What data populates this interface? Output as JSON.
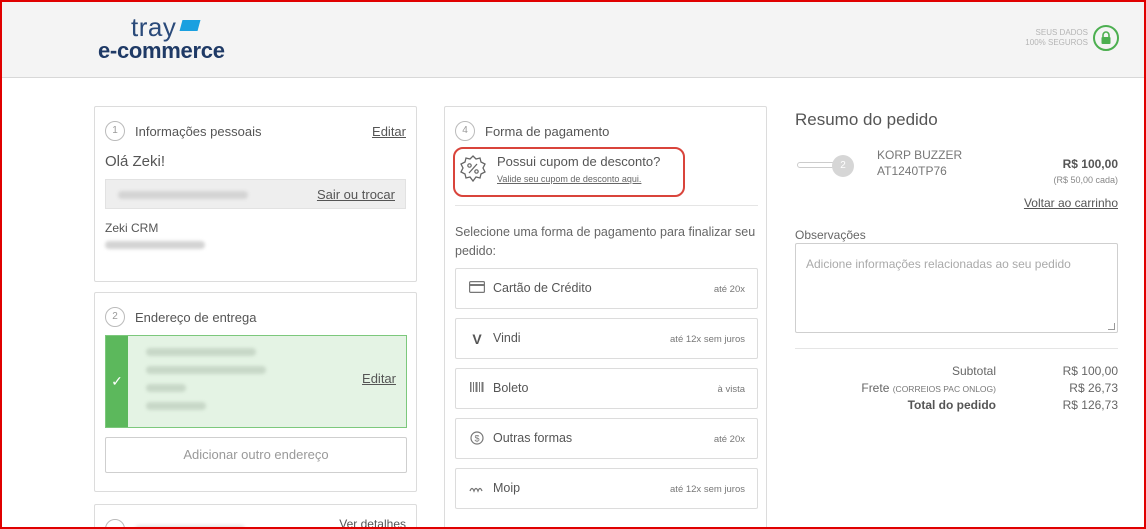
{
  "header": {
    "logo_top": "tray",
    "logo_bottom": "e-commerce",
    "secure_line1": "SEUS DADOS",
    "secure_line2": "100% SEGUROS"
  },
  "personal": {
    "step": "1",
    "title": "Informações pessoais",
    "edit": "Editar",
    "greeting": "Olá Zeki!",
    "switch_link": "Sair ou trocar",
    "name": "Zeki CRM"
  },
  "address": {
    "step": "2",
    "title": "Endereço de entrega",
    "edit": "Editar",
    "add_button": "Adicionar outro endereço"
  },
  "third": {
    "link": "Ver detalhes"
  },
  "payment": {
    "step": "4",
    "title": "Forma de pagamento",
    "coupon_title": "Possui cupom de desconto?",
    "coupon_link": "Valide seu cupom de desconto aqui.",
    "intro": "Selecione uma forma de pagamento para finalizar seu pedido:",
    "methods": [
      {
        "name": "Cartão de Crédito",
        "note": "até 20x",
        "icon": "credit-card-icon"
      },
      {
        "name": "Vindi",
        "note": "até 12x sem juros",
        "icon": "vindi-icon"
      },
      {
        "name": "Boleto",
        "note": "à vista",
        "icon": "barcode-icon"
      },
      {
        "name": "Outras formas",
        "note": "até 20x",
        "icon": "dollar-circle-icon"
      },
      {
        "name": "Moip",
        "note": "até 12x sem juros",
        "icon": "moip-icon"
      }
    ]
  },
  "summary": {
    "title": "Resumo do pedido",
    "quantity": "2",
    "product_line1": "KORP BUZZER",
    "product_line2": "AT1240TP76",
    "price": "R$ 100,00",
    "unit_price": "(R$ 50,00 cada)",
    "back_to_cart": "Voltar ao carrinho",
    "notes_label": "Observações",
    "notes_placeholder": "Adicione informações relacionadas ao seu pedido",
    "subtotal_label": "Subtotal",
    "subtotal": "R$ 100,00",
    "shipping_label": "Frete",
    "shipping_method": "(CORREIOS PAC ONLOG)",
    "shipping": "R$ 26,73",
    "total_label": "Total do pedido",
    "total": "R$ 126,73"
  },
  "colors": {
    "brand_blue": "#1f3a66",
    "accent_green": "#5cb85c",
    "highlight_red": "#d9443b"
  }
}
